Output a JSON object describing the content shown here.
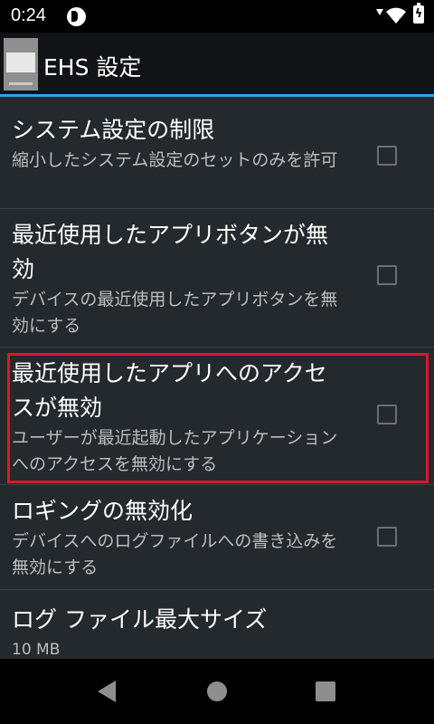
{
  "status_bar": {
    "time": "0:24",
    "signal_level": "5"
  },
  "action_bar": {
    "title": "EHS 設定"
  },
  "settings": [
    {
      "title": "システム設定の制限",
      "summary": "縮小したシステム設定のセットのみを許可",
      "checked": false
    },
    {
      "title": "最近使用したアプリボタンが無効",
      "summary": "デバイスの最近使用したアプリボタンを無効にする",
      "checked": false
    },
    {
      "title": "最近使用したアプリへのアクセスが無効",
      "summary": "ユーザーが最近起動したアプリケーションへのアクセスを無効にする",
      "checked": false,
      "highlighted": true
    },
    {
      "title": "ロギングの無効化",
      "summary": "デバイスへのログファイルへの書き込みを無効にする",
      "checked": false
    },
    {
      "title": "ログ ファイル最大サイズ",
      "summary": "10 MB"
    }
  ],
  "colors": {
    "accent": "#3d9fe0",
    "highlight_border": "#e0142a",
    "list_background": "#24292d"
  },
  "icons": [
    "back-icon",
    "home-icon",
    "recent-apps-icon",
    "wifi-icon",
    "battery-icon",
    "app-icon"
  ]
}
